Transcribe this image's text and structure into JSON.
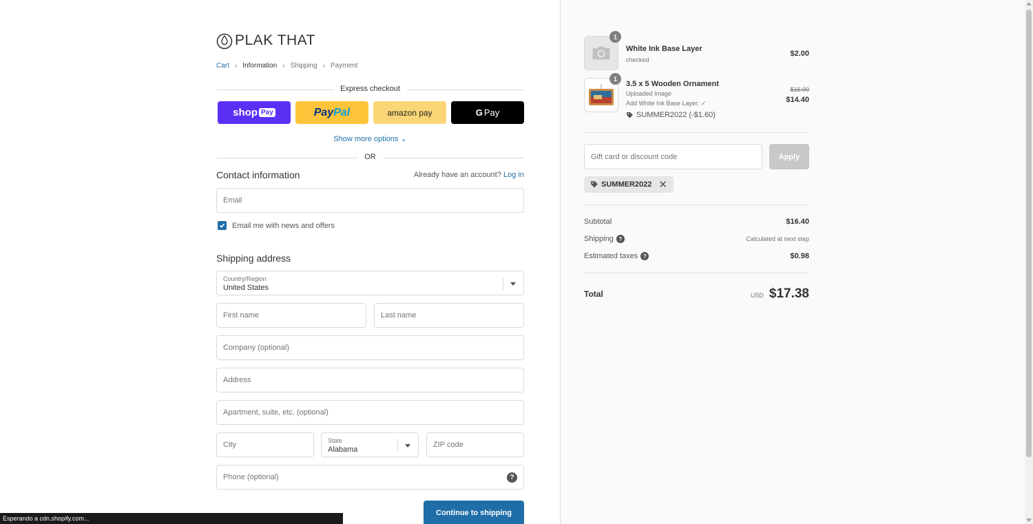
{
  "brand": {
    "name": "PLAK THAT"
  },
  "breadcrumb": [
    "Cart",
    "Information",
    "Shipping",
    "Payment"
  ],
  "express": {
    "title": "Express checkout",
    "shop_pay": {
      "text": "shop",
      "badge": "Pay"
    },
    "paypal": {
      "part1": "Pay",
      "part2": "Pal"
    },
    "amazon_pay": "amazon pay",
    "google_pay": {
      "g": "G",
      "text": "Pay"
    },
    "show_more": "Show more options"
  },
  "or_label": "OR",
  "contact": {
    "title": "Contact information",
    "account_prompt": "Already have an account?",
    "login_link": "Log in",
    "email_placeholder": "Email",
    "newsletter_label": "Email me with news and offers"
  },
  "shipping": {
    "title": "Shipping address",
    "country_label": "Country/Region",
    "country_value": "United States",
    "first_name_placeholder": "First name",
    "last_name_placeholder": "Last name",
    "company_placeholder": "Company (optional)",
    "address_placeholder": "Address",
    "apartment_placeholder": "Apartment, suite, etc. (optional)",
    "city_placeholder": "City",
    "state_label": "State",
    "state_value": "Alabama",
    "zip_placeholder": "ZIP code",
    "phone_placeholder": "Phone (optional)",
    "phone_help": "?"
  },
  "continue_label": "Continue to shipping",
  "status_bar": "Esperando a cdn.shopify.com...",
  "order": {
    "items": [
      {
        "qty": "1",
        "name": "White Ink Base Layer",
        "sub": "checked",
        "price": "$2.00"
      },
      {
        "qty": "1",
        "name": "3.5 x 5 Wooden Ornament",
        "sub1": "Uploaded Image",
        "sub2": "Add White Ink Base Layer: ✓",
        "discount": "SUMMER2022 (-$1.60)",
        "old_price": "$16.00",
        "price": "$14.40"
      }
    ],
    "gift_placeholder": "Gift card or discount code",
    "apply_label": "Apply",
    "applied_code": "SUMMER2022",
    "subtotal_label": "Subtotal",
    "subtotal_value": "$16.40",
    "shipping_label": "Shipping",
    "shipping_value": "Calculated at next step",
    "taxes_label": "Estimated taxes",
    "taxes_value": "$0.98",
    "total_label": "Total",
    "currency": "USD",
    "total_value": "$17.38",
    "help_mark": "?"
  },
  "colors": {
    "accent": "#1f6ea8",
    "shop_pay": "#5a31f4",
    "paypal": "#ffc439",
    "amazon": "#fad676",
    "gpay": "#000000"
  }
}
